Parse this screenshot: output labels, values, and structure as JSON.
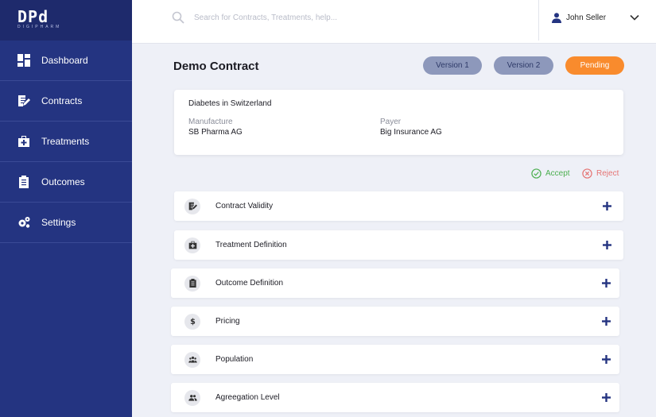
{
  "brand": {
    "mark": "DPd",
    "sub": "DIGIPHARM"
  },
  "sidebar": {
    "items": [
      {
        "label": "Dashboard",
        "icon": "dashboard-icon"
      },
      {
        "label": "Contracts",
        "icon": "contract-edit-icon"
      },
      {
        "label": "Treatments",
        "icon": "medical-kit-icon"
      },
      {
        "label": "Outcomes",
        "icon": "clipboard-icon"
      },
      {
        "label": "Settings",
        "icon": "gears-icon"
      }
    ]
  },
  "search": {
    "placeholder": "Search for Contracts, Treatments, help..."
  },
  "user": {
    "name": "John Seller"
  },
  "main": {
    "title": "Demo Contract",
    "versions": [
      "Version 1",
      "Version 2"
    ],
    "status": "Pending",
    "summary": {
      "heading": "Diabetes in Switzerland",
      "manufacture_label": "Manufacture",
      "manufacture_value": "SB Pharma AG",
      "payer_label": "Payer",
      "payer_value": "Big Insurance AG"
    },
    "accept_label": "Accept",
    "reject_label": "Reject",
    "sections": [
      {
        "title": "Contract Validity",
        "icon": "contract-edit-icon"
      },
      {
        "title": "Treatment Definition",
        "icon": "medical-kit-icon"
      },
      {
        "title": "Outcome Definition",
        "icon": "clipboard-icon"
      },
      {
        "title": "Pricing",
        "icon": "dollar-icon"
      },
      {
        "title": "Population",
        "icon": "people-icon"
      },
      {
        "title": "Agreegation Level",
        "icon": "group-icon"
      }
    ]
  },
  "colors": {
    "sidebar": "#243481",
    "pending": "#f98b2d",
    "version": "#8d98bb",
    "accept": "#4caf50",
    "reject": "#e57373"
  }
}
